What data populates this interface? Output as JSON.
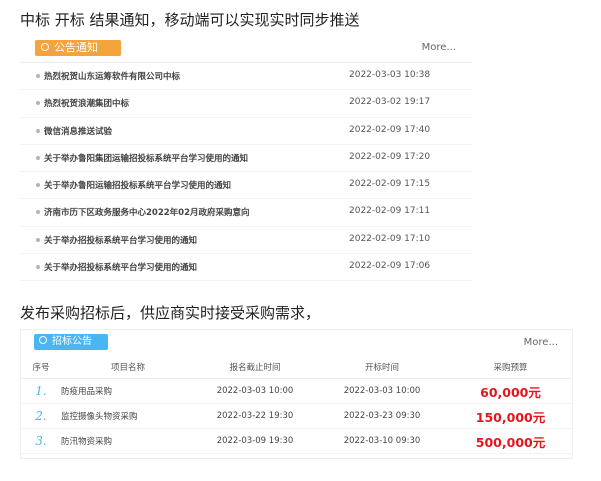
{
  "headings": {
    "top": "中标 开标 结果通知，移动端可以实现实时同步推送",
    "bottom": "发布采购招标后，供应商实时接受采购需求，"
  },
  "notice_panel": {
    "tab_label": "公告通知",
    "more_label": "More...",
    "items": [
      {
        "title": "热烈祝贺山东运筹软件有限公司中标",
        "date": "2022-03-03 10:38"
      },
      {
        "title": "热烈祝贺浪潮集团中标",
        "date": "2022-03-02 19:17"
      },
      {
        "title": "微信消息推送试验",
        "date": "2022-02-09 17:40"
      },
      {
        "title": "关于举办鲁阳集团运输招投标系统平台学习使用的通知",
        "date": "2022-02-09 17:20"
      },
      {
        "title": "关于举办鲁阳运输招投标系统平台学习使用的通知",
        "date": "2022-02-09 17:15"
      },
      {
        "title": "济南市历下区政务服务中心2022年02月政府采购意向",
        "date": "2022-02-09 17:11"
      },
      {
        "title": "关于举办招投标系统平台学习使用的通知",
        "date": "2022-02-09 17:10"
      },
      {
        "title": "关于举办招投标系统平台学习使用的通知",
        "date": "2022-02-09 17:06"
      }
    ]
  },
  "bid_panel": {
    "tab_label": "招标公告",
    "more_label": "More...",
    "columns": {
      "no": "序号",
      "name": "项目名称",
      "deadline": "报名截止时间",
      "open_time": "开标时间",
      "budget": "采购预算"
    },
    "rows": [
      {
        "no": "1.",
        "name": "防疫用品采购",
        "deadline": "2022-03-03 10:00",
        "open_time": "2022-03-03 10:00",
        "budget": "60,000元"
      },
      {
        "no": "2.",
        "name": "监控摄像头物资采购",
        "deadline": "2022-03-22 19:30",
        "open_time": "2022-03-23 09:30",
        "budget": "150,000元"
      },
      {
        "no": "3.",
        "name": "防汛物资采购",
        "deadline": "2022-03-09 19:30",
        "open_time": "2022-03-10 09:30",
        "budget": "500,000元"
      }
    ]
  },
  "colors": {
    "notice_tab": "#f5a33b",
    "bid_tab": "#4ab5f0",
    "budget": "#e8141b"
  }
}
